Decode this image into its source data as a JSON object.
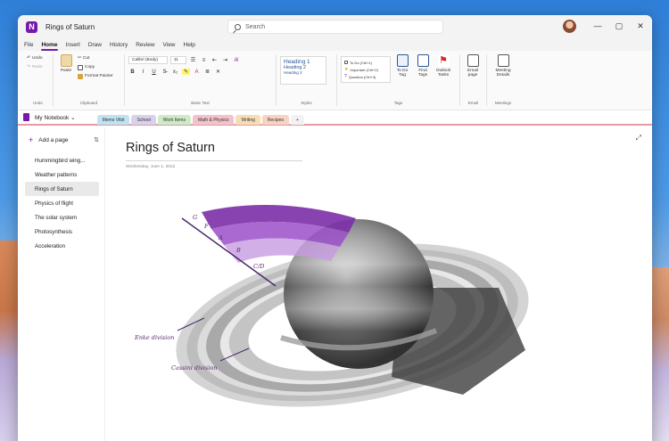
{
  "window": {
    "title": "Rings of Saturn",
    "search_placeholder": "Search",
    "app_icon_letter": "N",
    "controls": {
      "minimize": "—",
      "maximize": "▢",
      "close": "✕"
    }
  },
  "menu": {
    "items": [
      "File",
      "Home",
      "Insert",
      "Draw",
      "History",
      "Review",
      "View",
      "Help"
    ],
    "active": "Home"
  },
  "ribbon": {
    "undo": {
      "undo": "Undo",
      "redo": "Redo",
      "group": "Undo"
    },
    "clipboard": {
      "paste": "Paste",
      "cut": "Cut",
      "copy": "Copy",
      "format_painter": "Format Painter",
      "group": "Clipboard"
    },
    "basic_text": {
      "font": "Calibri (Body)",
      "size": "11",
      "group": "Basic Text"
    },
    "styles": {
      "h1": "Heading 1",
      "h2": "Heading 2",
      "h3": "Heading 3",
      "group": "Styles"
    },
    "tags": {
      "items": [
        "To Do (Ctrl+1)",
        "Important (Ctrl+2)",
        "Question (Ctrl+3)"
      ],
      "todo_tag": "To Do Tag",
      "find_tags": "Find Tags",
      "outlook_tasks": "Outlook Tasks",
      "group": "Tags"
    },
    "email": {
      "label": "Email page",
      "group": "Email"
    },
    "meetings": {
      "label": "Meeting Details",
      "group": "Meetings"
    }
  },
  "notebook": {
    "name": "My Notebook",
    "sections": [
      {
        "label": "Memo Vibit",
        "color": "#bfe3f2"
      },
      {
        "label": "School",
        "color": "#d9d2ea"
      },
      {
        "label": "Work Items",
        "color": "#cdebc9"
      },
      {
        "label": "Math & Physics",
        "color": "#f3c3cb"
      },
      {
        "label": "Writing",
        "color": "#f6ddb5"
      },
      {
        "label": "Recipes",
        "color": "#f9d3c2"
      },
      {
        "label": "+",
        "color": "#f2f2f2"
      }
    ]
  },
  "pages": {
    "add_label": "Add a page",
    "items": [
      "Hummingbird wing...",
      "Weather patterns",
      "Rings of Saturn",
      "Physics of flight",
      "The solar system",
      "Photosynthesis",
      "Acceleration"
    ],
    "active_index": 2
  },
  "page": {
    "title": "Rings of Saturn",
    "date": "Wednesday, June 1, 2022",
    "ink_annotations": {
      "rings": [
        "G",
        "F",
        "A",
        "B",
        "C/D"
      ],
      "encke": "Enke division",
      "cassini": "Cassini division"
    }
  },
  "colors": {
    "accent": "#7719aa",
    "ring_purple": "#7b2fa8",
    "section_underline": "#e59aa6"
  }
}
